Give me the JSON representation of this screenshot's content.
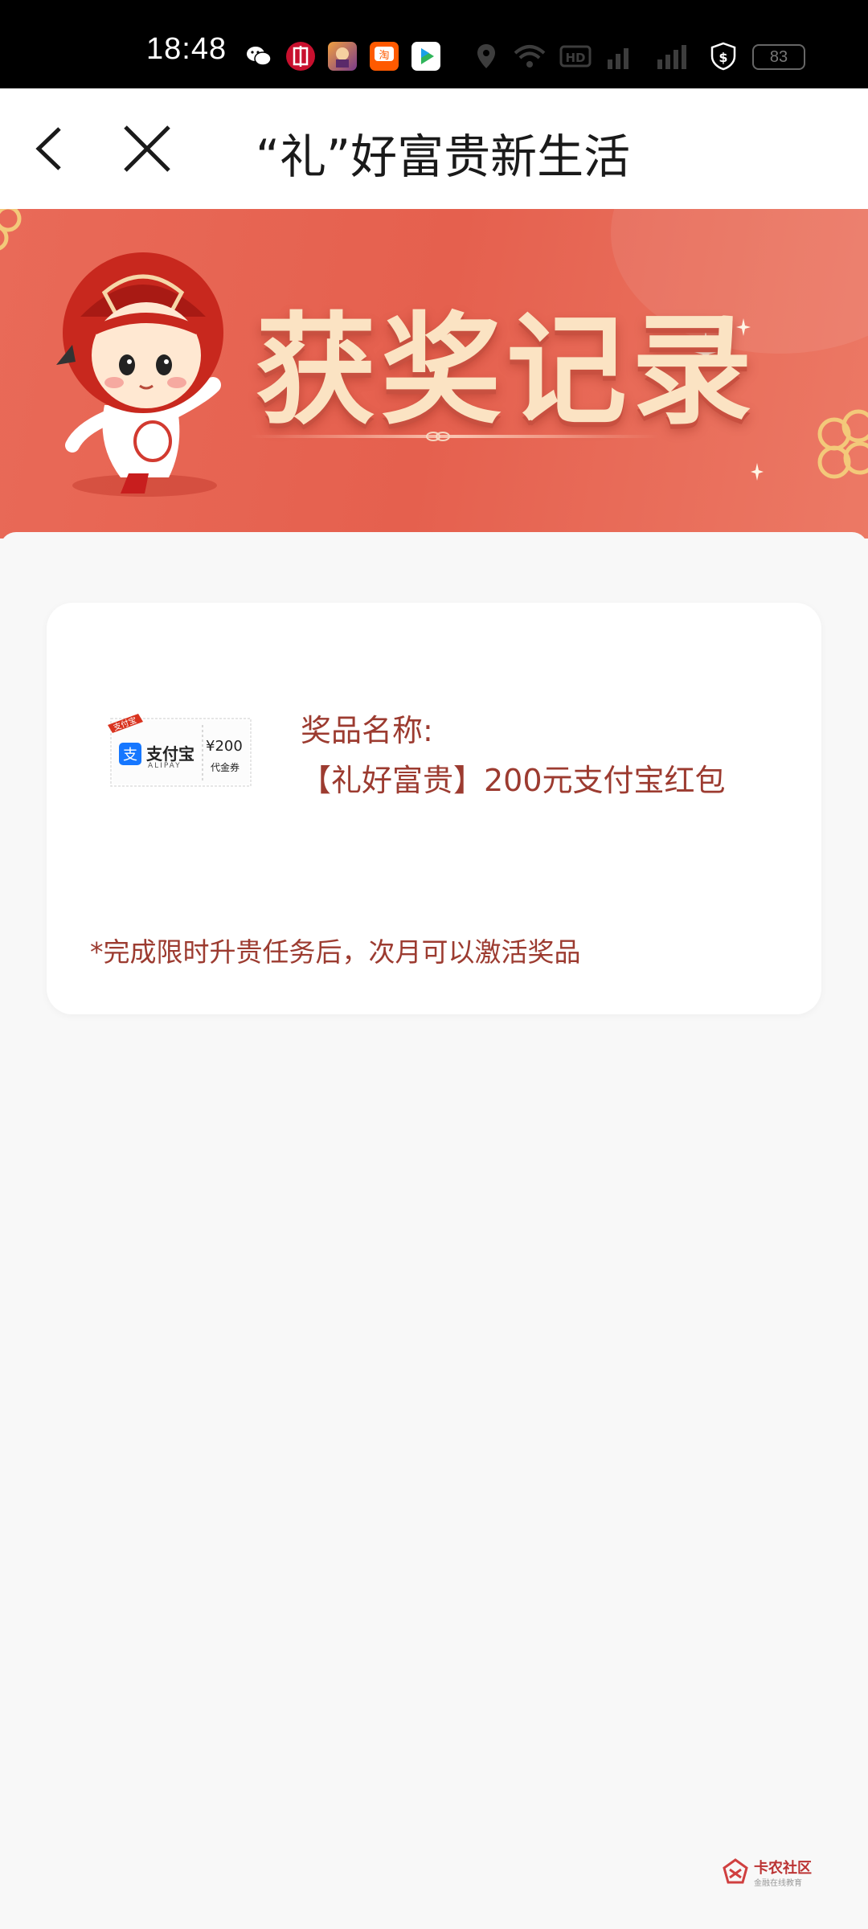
{
  "status_bar": {
    "time": "18:48",
    "battery": "83",
    "icons": [
      "wechat-icon",
      "citic-bank-icon",
      "game-icon",
      "taobao-icon",
      "video-icon",
      "location-icon",
      "wifi-icon",
      "hd-icon",
      "signal-icon",
      "signal-icon",
      "shield-dollar-icon"
    ]
  },
  "nav": {
    "title": "“礼”好富贵新生活",
    "back_icon": "chevron-left-icon",
    "close_icon": "close-icon"
  },
  "banner": {
    "title": "获奖记录",
    "colors": {
      "background": "#e5604e",
      "title": "#fbe3c3"
    }
  },
  "card": {
    "coupon": {
      "corner_tag": "支付宝",
      "brand": "支付宝",
      "brand_en": "ALIPAY",
      "amount": "¥200",
      "amount_label": "代金券"
    },
    "prize_label": "奖品名称:",
    "prize_name": "【礼好富贵】200元支付宝红包",
    "note": "*完成限时升贵任务后，次月可以激活奖品"
  },
  "watermark": {
    "text": "卡农社区",
    "subtext": "金融在线教育"
  }
}
